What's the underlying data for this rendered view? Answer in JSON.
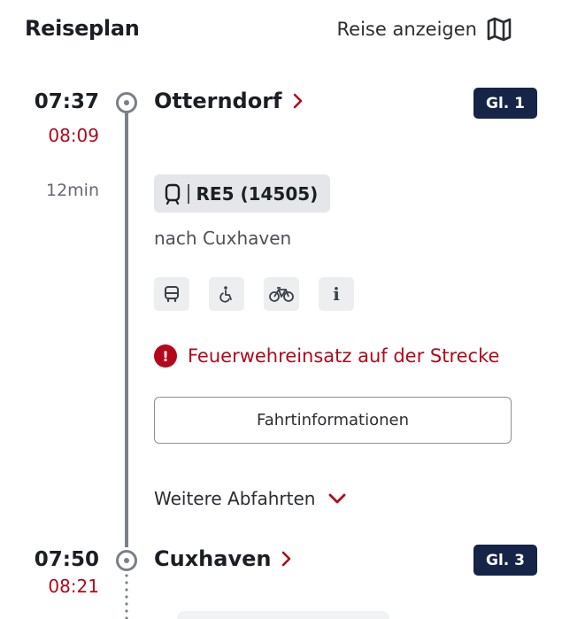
{
  "header": {
    "title": "Reiseplan",
    "show_trip_label": "Reise anzeigen",
    "show_trip_icon": "map-icon"
  },
  "stops": [
    {
      "planned_time": "07:37",
      "actual_time": "08:09",
      "station": "Otterndorf",
      "platform": "Gl. 1"
    },
    {
      "planned_time": "07:50",
      "actual_time": "08:21",
      "station": "Cuxhaven",
      "platform": "Gl. 3"
    }
  ],
  "leg": {
    "duration": "12min",
    "train_icon": "train-icon",
    "train_line": "RE5 (14505)",
    "direction": "nach Cuxhaven",
    "amenities": [
      {
        "name": "bus-icon"
      },
      {
        "name": "wheelchair-icon"
      },
      {
        "name": "bicycle-icon"
      },
      {
        "name": "info-icon",
        "glyph": "i"
      }
    ],
    "alert_glyph": "!",
    "alert_text": "Feuerwehreinsatz auf der Strecke",
    "info_button_label": "Fahrtinformationen",
    "more_departures_label": "Weitere Abfahrten"
  },
  "colors": {
    "delay": "#b3081b",
    "platform_badge": "#152447",
    "timeline": "#7a8089"
  }
}
